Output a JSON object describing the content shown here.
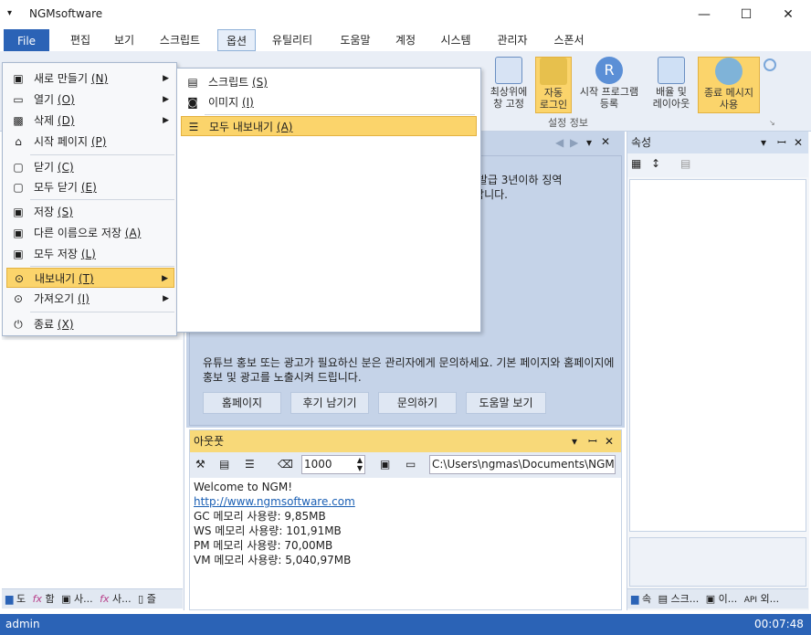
{
  "window": {
    "title": "NGMsoftware",
    "min": "—",
    "max": "☐",
    "close": "✕"
  },
  "menubar": [
    "File",
    "편집",
    "보기",
    "스크립트",
    "옵션",
    "유틸리티",
    "도움말",
    "계정",
    "시스템",
    "관리자",
    "스폰서"
  ],
  "ribbon": {
    "buttons": [
      {
        "label": "최상위에\n창 고정",
        "icon": "window-icon"
      },
      {
        "label": "자동\n로그인",
        "icon": "key-icon",
        "hl": true
      },
      {
        "label": "시작 프로그램\n등록",
        "icon": "r-icon"
      },
      {
        "label": "배율 및\n레이아웃",
        "icon": "monitor-icon"
      },
      {
        "label": "종료 메시지\n사용",
        "icon": "message-icon",
        "hl": true
      }
    ],
    "group_label": "설정 정보"
  },
  "file_menu": {
    "items": [
      {
        "label": "새로 만들기",
        "key": "(N)",
        "sub": true
      },
      {
        "label": "열기",
        "key": "(O)",
        "sub": true
      },
      {
        "label": "삭제",
        "key": "(D)",
        "sub": true
      },
      {
        "label": "시작 페이지",
        "key": "(P)",
        "sub": false
      },
      {
        "label": "닫기",
        "key": "(C)",
        "sub": false
      },
      {
        "label": "모두 닫기",
        "key": "(E)",
        "sub": false
      },
      {
        "label": "저장",
        "key": "(S)",
        "sub": false
      },
      {
        "label": "다른 이름으로 저장",
        "key": "(A)",
        "sub": false
      },
      {
        "label": "모두 저장",
        "key": "(L)",
        "sub": false
      },
      {
        "label": "내보내기",
        "key": "(T)",
        "sub": true,
        "hl": true
      },
      {
        "label": "가져오기",
        "key": "(I)",
        "sub": true
      },
      {
        "label": "종료",
        "key": "(X)",
        "sub": false
      }
    ]
  },
  "export_menu": {
    "items": [
      {
        "label": "스크립트",
        "key": "(S)"
      },
      {
        "label": "이미지",
        "key": "(I)"
      },
      {
        "label": "모두 내보내기",
        "key": "(A)",
        "hl": true
      }
    ]
  },
  "center": {
    "notice_top": "의 발급 3년이하 징역\n바랍니다.",
    "promo": "유튜브 홍보 또는 광고가 필요하신 분은 관리자에게 문의하세요. 기본 페이지와 홈페이지에 홍보 및 광고를 노출시켜 드립니다.",
    "buttons": [
      "홈페이지",
      "후기 남기기",
      "문의하기",
      "도움말 보기"
    ]
  },
  "output": {
    "title": "아웃풋",
    "count": "1000",
    "path": "C:\\Users\\ngmas\\Documents\\NGM6\\",
    "lines": [
      "Welcome to NGM!",
      "http://www.ngmsoftware.com",
      "GC 메모리 사용량: 9,85MB",
      "WS 메모리 사용량: 101,91MB",
      "PM 메모리 사용량: 70,00MB",
      "VM 메모리 사용량: 5,040,97MB"
    ]
  },
  "properties": {
    "title": "속성",
    "tabs": [
      "속",
      "스크...",
      "이...",
      "외..."
    ]
  },
  "left_tabs": [
    "도",
    "함",
    "사...",
    "사...",
    "즐"
  ],
  "status": {
    "user": "admin",
    "time": "00:07:48"
  },
  "colors": {
    "accent": "#2b63b6",
    "highlight": "#fbd46b"
  }
}
